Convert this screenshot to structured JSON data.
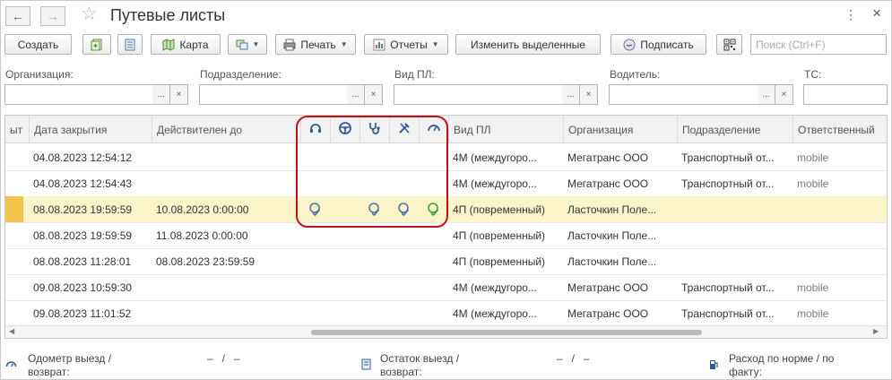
{
  "window": {
    "title": "Путевые листы",
    "back_icon": "←",
    "forward_icon": "→",
    "more_icon": "⋮",
    "close_icon": "×"
  },
  "toolbar": {
    "create_label": "Создать",
    "map_label": "Карта",
    "print_label": "Печать",
    "reports_label": "Отчеты",
    "edit_selected_label": "Изменить выделенные",
    "sign_label": "Подписать",
    "search_placeholder": "Поиск (Ctrl+F)"
  },
  "filters": [
    {
      "label": "Организация:"
    },
    {
      "label": "Подразделение:"
    },
    {
      "label": "Вид ПЛ:"
    },
    {
      "label": "Водитель:"
    },
    {
      "label": "ТС:"
    }
  ],
  "filter_buttons": {
    "select": "...",
    "clear": "×"
  },
  "table": {
    "headers": {
      "c0": "ыт",
      "close_date": "Дата закрытия",
      "valid_until": "Действителен до",
      "type": "Вид ПЛ",
      "org": "Организация",
      "dept": "Подразделение",
      "resp": "Ответственный"
    },
    "header_icons": [
      "headset-icon",
      "steering-wheel-icon",
      "stethoscope-icon",
      "tools-icon",
      "speedometer-icon"
    ],
    "rows": [
      {
        "close_date": "04.08.2023 12:54:12",
        "valid_until": "",
        "checks": [
          false,
          false,
          false,
          false,
          false
        ],
        "type": "4М (междугоро...",
        "org": "Мегатранс ООО",
        "dept": "Транспортный от...",
        "resp": "mobile"
      },
      {
        "close_date": "04.08.2023 12:54:43",
        "valid_until": "",
        "checks": [
          false,
          false,
          false,
          false,
          false
        ],
        "type": "4М (междугоро...",
        "org": "Мегатранс ООО",
        "dept": "Транспортный от...",
        "resp": "mobile"
      },
      {
        "close_date": "08.08.2023 19:59:59",
        "valid_until": "10.08.2023 0:00:00",
        "checks": [
          true,
          false,
          true,
          true,
          true
        ],
        "type": "4П (повременный)",
        "org": "Ласточкин Поле...",
        "dept": "",
        "resp": "",
        "selected": true
      },
      {
        "close_date": "08.08.2023 19:59:59",
        "valid_until": "11.08.2023 0:00:00",
        "checks": [
          false,
          false,
          false,
          false,
          false
        ],
        "type": "4П (повременный)",
        "org": "Ласточкин Поле...",
        "dept": "",
        "resp": ""
      },
      {
        "close_date": "08.08.2023 11:28:01",
        "valid_until": "08.08.2023 23:59:59",
        "checks": [
          false,
          false,
          false,
          false,
          false
        ],
        "type": "4П (повременный)",
        "org": "Ласточкин Поле...",
        "dept": "",
        "resp": ""
      },
      {
        "close_date": "09.08.2023 10:59:30",
        "valid_until": "",
        "checks": [
          false,
          false,
          false,
          false,
          false
        ],
        "type": "4М (междугоро...",
        "org": "Мегатранс ООО",
        "dept": "Транспортный от...",
        "resp": "mobile"
      },
      {
        "close_date": "09.08.2023 11:01:52",
        "valid_until": "",
        "checks": [
          false,
          false,
          false,
          false,
          false
        ],
        "type": "4М (междугоро...",
        "org": "Мегатранс ООО",
        "dept": "Транспортный от...",
        "resp": "mobile"
      }
    ]
  },
  "footer": {
    "odometer_label": "Одометр выезд / возврат:",
    "odometer_value": "–   /   –",
    "remainder_label": "Остаток выезд / возврат:",
    "remainder_value": "–   /   –",
    "consumption_label": "Расход по норме / по факту:"
  },
  "colors": {
    "highlight": "#c0101c",
    "selected_row": "#fdf4c9",
    "selected_marker": "#f3c34a",
    "check_blue": "#4a6fa5",
    "check_green": "#3f9a3a"
  }
}
